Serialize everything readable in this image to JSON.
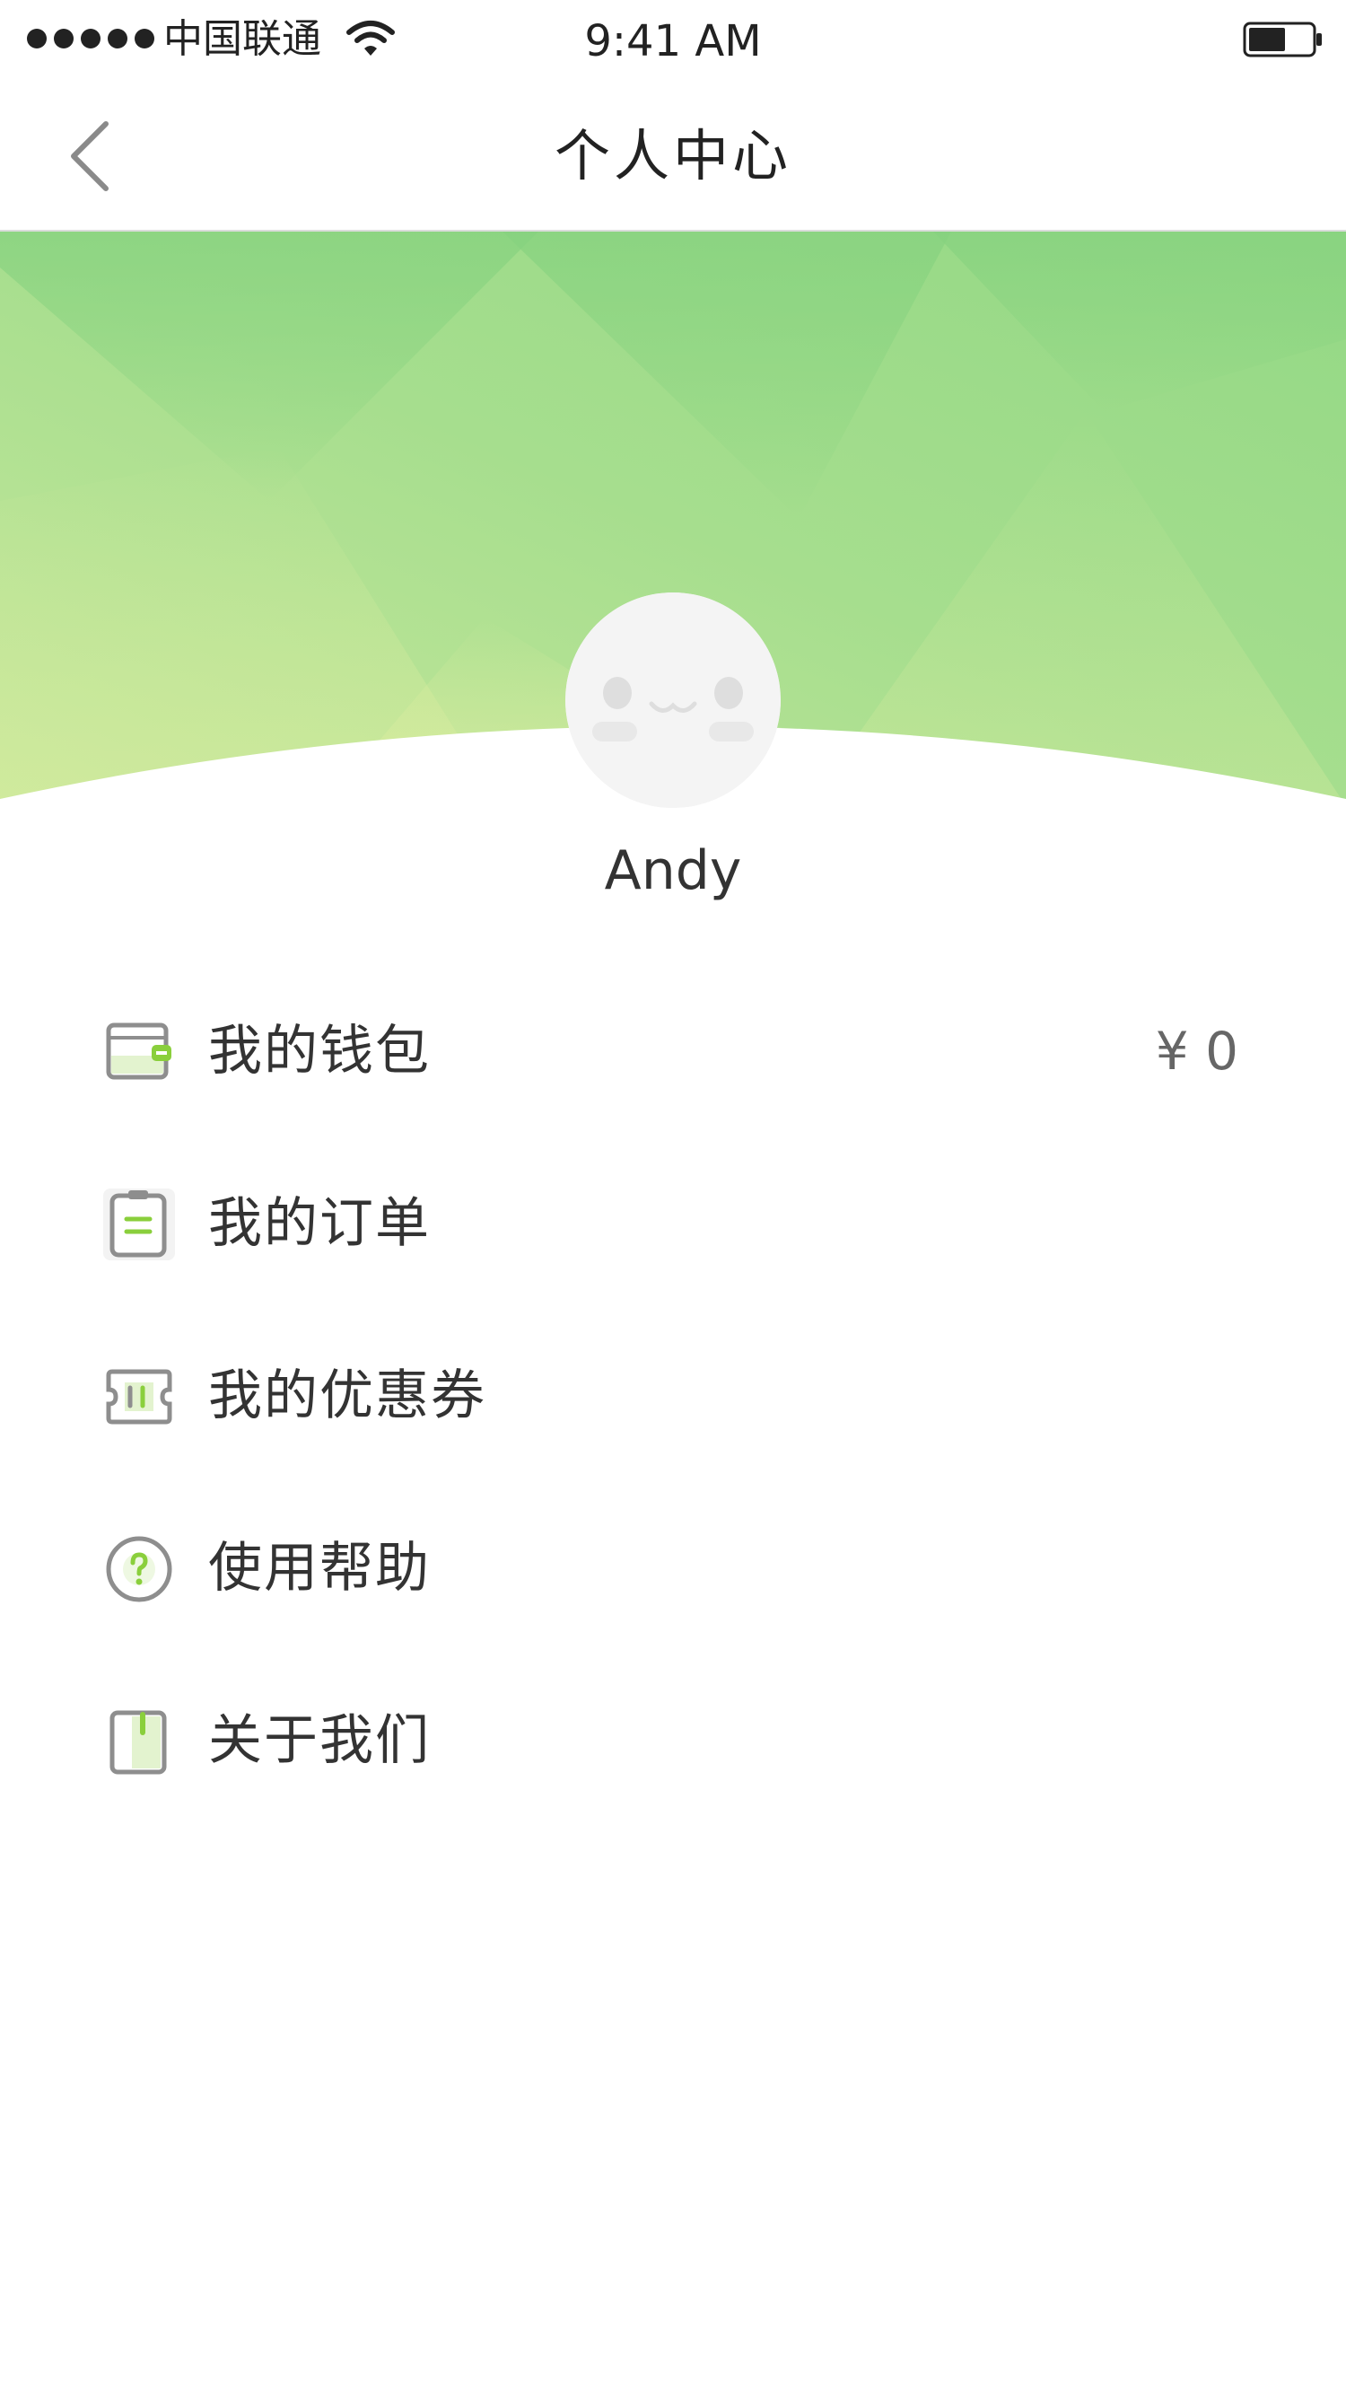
{
  "status_bar": {
    "carrier": "中国联通",
    "time": "9:41 AM",
    "signal_icon": "signal-dots-icon",
    "wifi_icon": "wifi-icon",
    "battery_icon": "battery-icon",
    "battery_level_fraction": 0.5
  },
  "nav": {
    "title": "个人中心",
    "back_icon": "chevron-left-icon"
  },
  "profile": {
    "username": "Andy",
    "avatar_icon": "default-face-avatar"
  },
  "menu": {
    "items": [
      {
        "label": "我的钱包",
        "icon": "wallet-icon",
        "value": "¥ 0"
      },
      {
        "label": "我的订单",
        "icon": "order-clipboard-icon",
        "value": ""
      },
      {
        "label": "我的优惠券",
        "icon": "coupon-ticket-icon",
        "value": ""
      },
      {
        "label": "使用帮助",
        "icon": "help-question-icon",
        "value": ""
      },
      {
        "label": "关于我们",
        "icon": "about-book-icon",
        "value": ""
      }
    ]
  },
  "colors": {
    "accent_green": "#8ACF3C",
    "banner_green_light": "#C5E89A",
    "banner_green_dark": "#8ED785",
    "icon_gray": "#8E8E8E",
    "text_primary": "#333333",
    "text_secondary": "#666666",
    "avatar_bg": "#F4F4F4"
  }
}
